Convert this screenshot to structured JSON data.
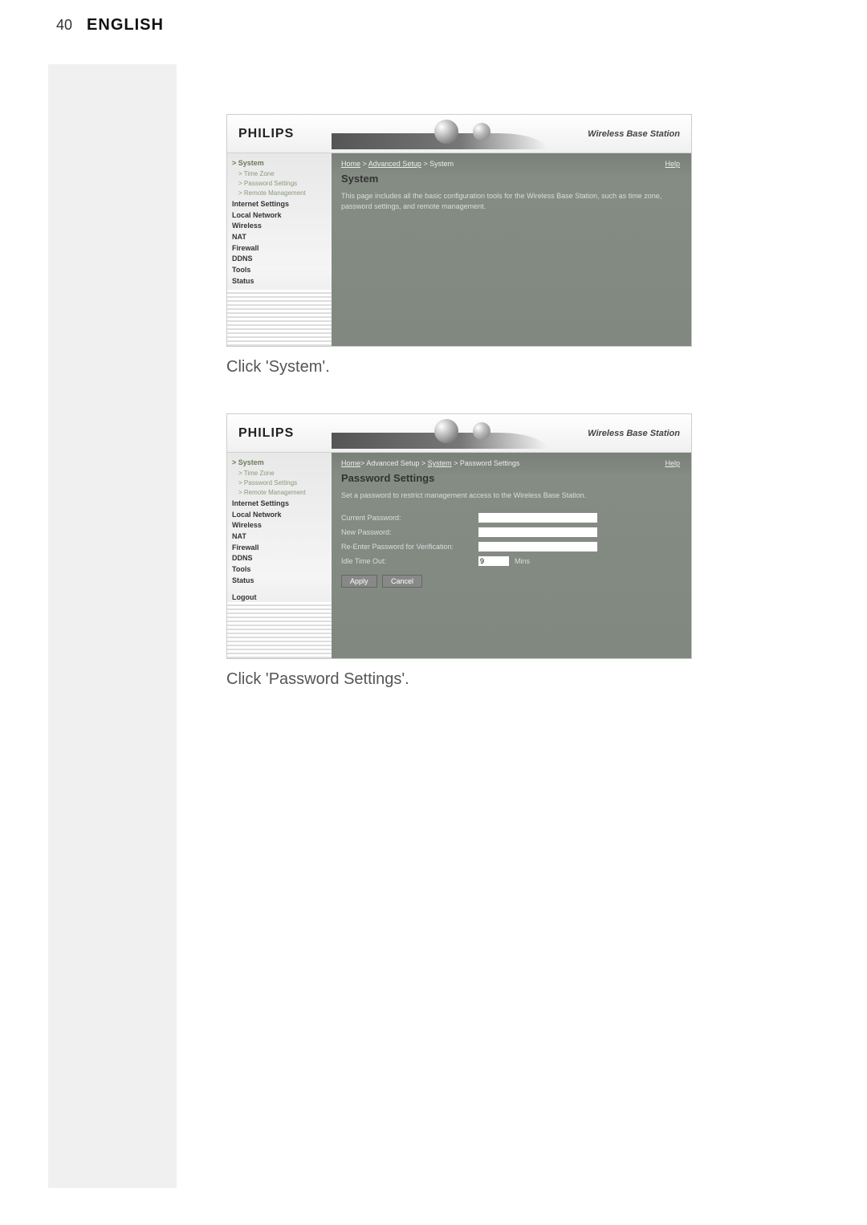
{
  "page": {
    "number": "40",
    "lang": "ENGLISH"
  },
  "captions": {
    "systemClick": "Click 'System'.",
    "passwordClick": "Click 'Password Settings'."
  },
  "router": {
    "logo": "PHILIPS",
    "brand": "Wireless Base Station",
    "helpLabel": "Help",
    "sidebar": {
      "system": "System",
      "timeZone": "Time Zone",
      "passwordSettings": "Password Settings",
      "remoteManagement": "Remote Management",
      "internetSettings": "Internet Settings",
      "localNetwork": "Local Network",
      "wireless": "Wireless",
      "nat": "NAT",
      "firewall": "Firewall",
      "ddns": "DDNS",
      "tools": "Tools",
      "status": "Status",
      "logout": "Logout"
    }
  },
  "screen1": {
    "breadcrumb": {
      "home": "Home",
      "adv": "Advanced Setup",
      "sys": "System"
    },
    "title": "System",
    "desc": "This page includes all the basic configuration tools for the Wireless Base Station, such as time zone, password settings, and remote management."
  },
  "screen2": {
    "breadcrumb": {
      "home": "Home",
      "adv": "Advanced Setup",
      "sys": "System",
      "pw": "Password Settings"
    },
    "title": "Password Settings",
    "desc": "Set a password to restrict management access to the Wireless Base Station.",
    "labels": {
      "current": "Current Password:",
      "new": "New Password:",
      "reenter": "Re-Enter Password for Verification:",
      "idle": "Idle Time Out:"
    },
    "idleValue": "9",
    "minsLabel": "Mins",
    "apply": "Apply",
    "cancel": "Cancel"
  }
}
